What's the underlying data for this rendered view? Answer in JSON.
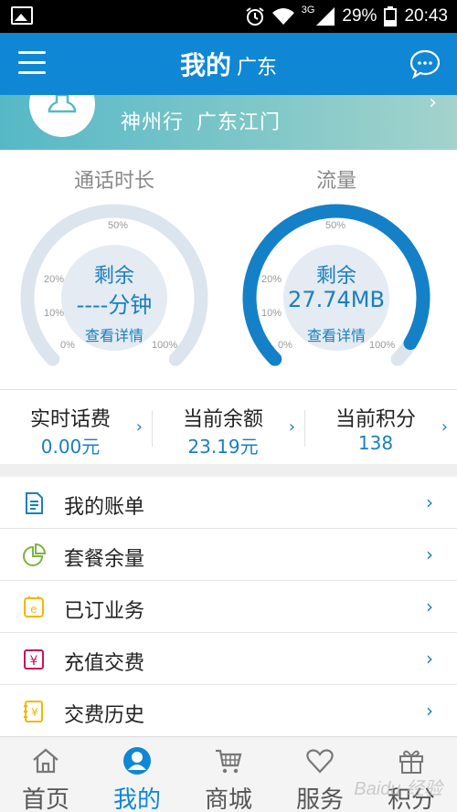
{
  "status_bar": {
    "network": "3G",
    "battery": "29%",
    "time": "20:43"
  },
  "header": {
    "title": "我的",
    "region": "广东"
  },
  "profile": {
    "brand": "神州行",
    "location": "广东江门"
  },
  "gauges": {
    "call": {
      "title": "通话时长",
      "remain_label": "剩余",
      "value": "----分钟",
      "detail": "查看详情",
      "fill": 0
    },
    "data": {
      "title": "流量",
      "remain_label": "剩余",
      "value": "27.74MB",
      "detail": "查看详情",
      "fill": 0.95
    },
    "ticks": {
      "t0": "0%",
      "t10": "10%",
      "t20": "20%",
      "t50": "50%",
      "t100": "100%"
    },
    "colors": {
      "track": "#dce5ee",
      "fill": "#1480c8",
      "inner": "#e4ebf2"
    }
  },
  "stats": [
    {
      "label": "实时话费",
      "value": "0.00元"
    },
    {
      "label": "当前余额",
      "value": "23.19元"
    },
    {
      "label": "当前积分",
      "value": "138"
    }
  ],
  "menu": [
    {
      "label": "我的账单",
      "icon": "bill-icon"
    },
    {
      "label": "套餐余量",
      "icon": "pie-chart-icon"
    },
    {
      "label": "已订业务",
      "icon": "subscribed-service-icon"
    },
    {
      "label": "充值交费",
      "icon": "recharge-icon"
    },
    {
      "label": "交费历史",
      "icon": "payment-history-icon"
    }
  ],
  "bottom_nav": [
    {
      "label": "首页",
      "icon": "home-icon"
    },
    {
      "label": "我的",
      "icon": "user-icon",
      "active": true
    },
    {
      "label": "商城",
      "icon": "cart-icon"
    },
    {
      "label": "服务",
      "icon": "heart-icon"
    },
    {
      "label": "积分",
      "icon": "gift-icon"
    }
  ],
  "watermark": "Baidu 经验",
  "accent": "#0f87d4"
}
